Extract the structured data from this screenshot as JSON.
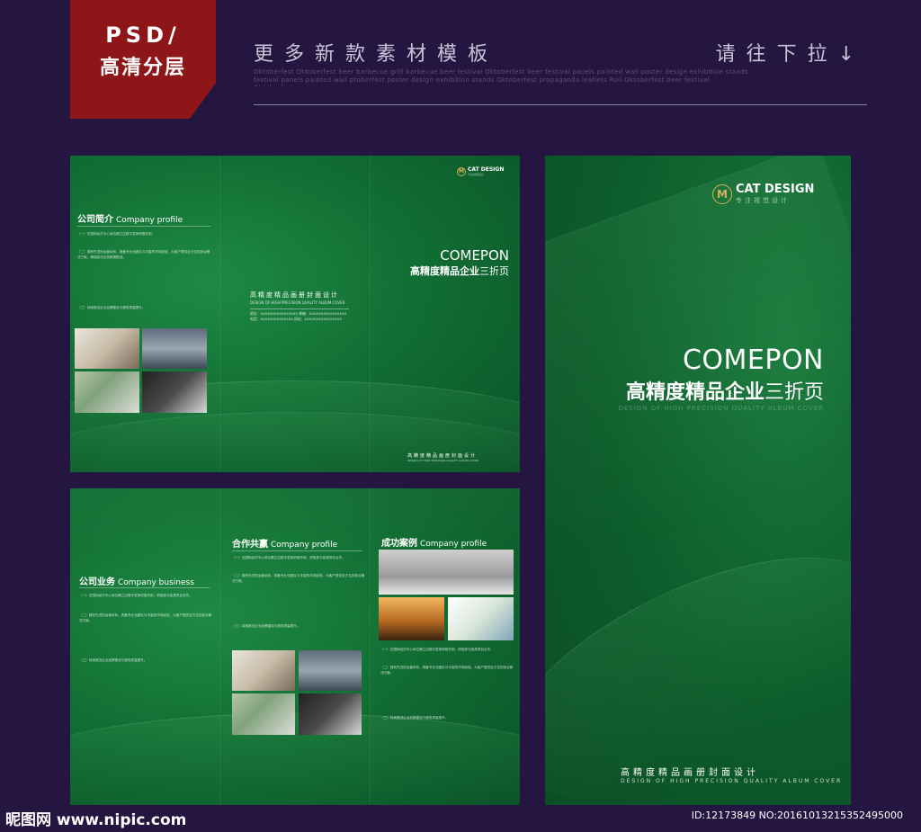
{
  "banner": {
    "badge_line1": "PSD/",
    "badge_line2": "高清分层",
    "headline": "更多新款素材模板",
    "headline_right": "请往下拉↓",
    "subline": "Oktoberfest Oktoberfest beer barbecue grill barbecue beer festival Oktoberfest beer festival panels painted wall poster design exhibition stands festival panels painted wall ptoberfest poster design exhibition stands Oktoberfest propaganda leaflets Roll Oktoberfest beer festival Oktoberfest"
  },
  "brand": {
    "logo_letter": "M",
    "name": "CAT DESIGN",
    "tagline": "专注视觉设计"
  },
  "cover": {
    "title_en": "COMEPON",
    "title_cn_bold": "高精度精品企业",
    "title_cn_thin": "三折页",
    "subtitle_en": "DESIGN OF HIGH PRECISION QUALITY ALBUM COVER",
    "footer_cn": "高精度精品画册封面设计",
    "footer_en": "DESIGN OF HIGH PRECISION QUALITY ALBUM COVER"
  },
  "panel_top": {
    "section_cn": "公司简介",
    "section_en": "Company profile",
    "body_1": "（一）在国际经济中心地位确立过程中发挥积极作用。",
    "body_2": "（二）拥有先进的运营体系，具备专业化团队与丰富的市场经验，为客户提供全方位的综合解决方案，确保各项业务稳健推进。",
    "body_3": "（三）持续推进企业品牌建设与服务质量提升。",
    "mid_title_cn": "高精度精品画册封面设计",
    "mid_title_en": "DESIGN OF HIGH PRECISION QUALITY ALBUM COVER",
    "contact_1": "地址：XXXXXXXXXXXXXXXX    邮箱：XXXXXXXXXXXXXXXX",
    "contact_2": "电话：XXXXXXXXXXXXXX    网站：XXXXXXXXXXXXXXXX",
    "right_title_en": "COMEPON",
    "right_title_cn_bold": "高精度精品企业",
    "right_title_cn_thin": "三折页",
    "footer_cn": "高精度精品画册封面设计",
    "footer_en": "DESIGN OF HIGH PRECISION QUALITY ALBUM COVER"
  },
  "panel_bottom": {
    "col1_cn": "公司业务",
    "col1_en": "Company business",
    "col2_cn": "合作共赢",
    "col2_en": "Company profile",
    "col3_cn": "成功案例",
    "col3_en": "Company profile",
    "body_a": "（一）在国际经济中心地位确立过程中发挥积极作用，积极参与各类项目合作。",
    "body_b": "（二）拥有先进的运营体系，具备专业化团队与丰富的市场经验，为客户提供全方位的综合解决方案。",
    "body_c": "（三）持续推进企业品牌建设与服务质量提升。"
  },
  "watermark": {
    "left": "昵图网 www.nipic.com",
    "right": "ID:12173849 NO:20161013215352495000"
  }
}
